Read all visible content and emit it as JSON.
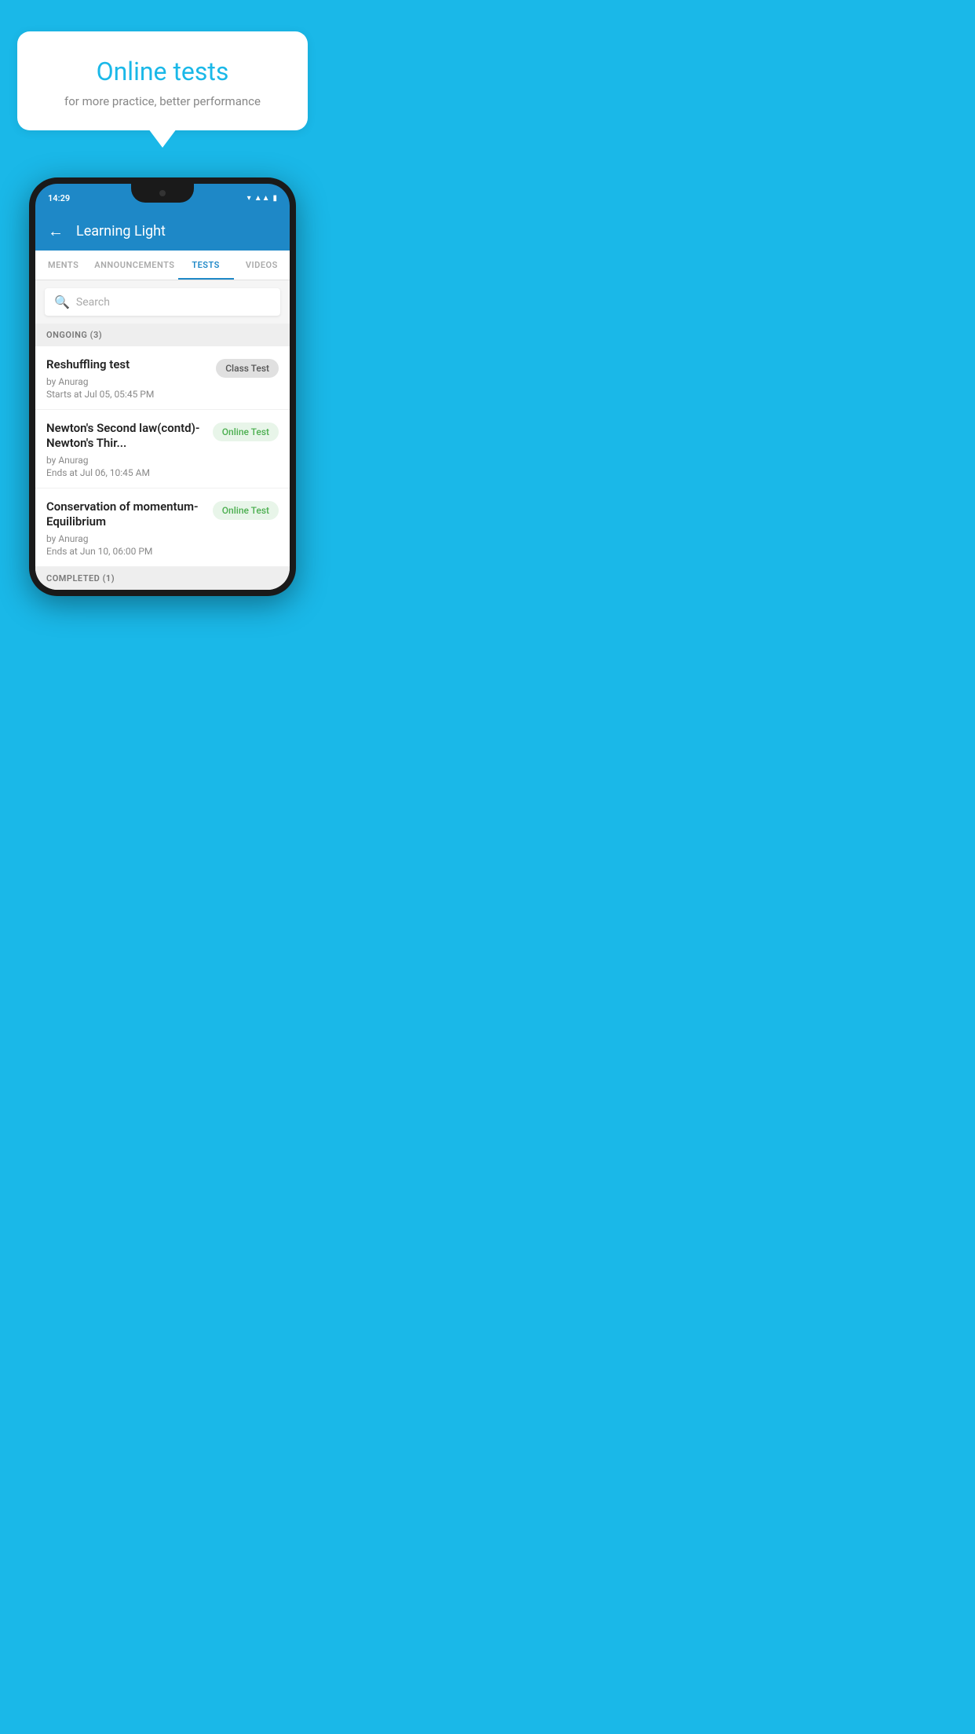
{
  "background_color": "#1ab8e8",
  "speech_bubble": {
    "title": "Online tests",
    "subtitle": "for more practice, better performance"
  },
  "phone": {
    "status_bar": {
      "time": "14:29",
      "icons": [
        "wifi",
        "signal",
        "battery"
      ]
    },
    "app_bar": {
      "title": "Learning Light",
      "back_label": "←"
    },
    "tabs": [
      {
        "label": "MENTS",
        "active": false
      },
      {
        "label": "ANNOUNCEMENTS",
        "active": false
      },
      {
        "label": "TESTS",
        "active": true
      },
      {
        "label": "VIDEOS",
        "active": false
      }
    ],
    "search": {
      "placeholder": "Search"
    },
    "sections": [
      {
        "header": "ONGOING (3)",
        "items": [
          {
            "name": "Reshuffling test",
            "by": "by Anurag",
            "time_label": "Starts at",
            "time": "Jul 05, 05:45 PM",
            "badge": "Class Test",
            "badge_type": "class"
          },
          {
            "name": "Newton's Second law(contd)-Newton's Thir...",
            "by": "by Anurag",
            "time_label": "Ends at",
            "time": "Jul 06, 10:45 AM",
            "badge": "Online Test",
            "badge_type": "online"
          },
          {
            "name": "Conservation of momentum-Equilibrium",
            "by": "by Anurag",
            "time_label": "Ends at",
            "time": "Jun 10, 06:00 PM",
            "badge": "Online Test",
            "badge_type": "online"
          }
        ]
      },
      {
        "header": "COMPLETED (1)",
        "items": []
      }
    ]
  }
}
